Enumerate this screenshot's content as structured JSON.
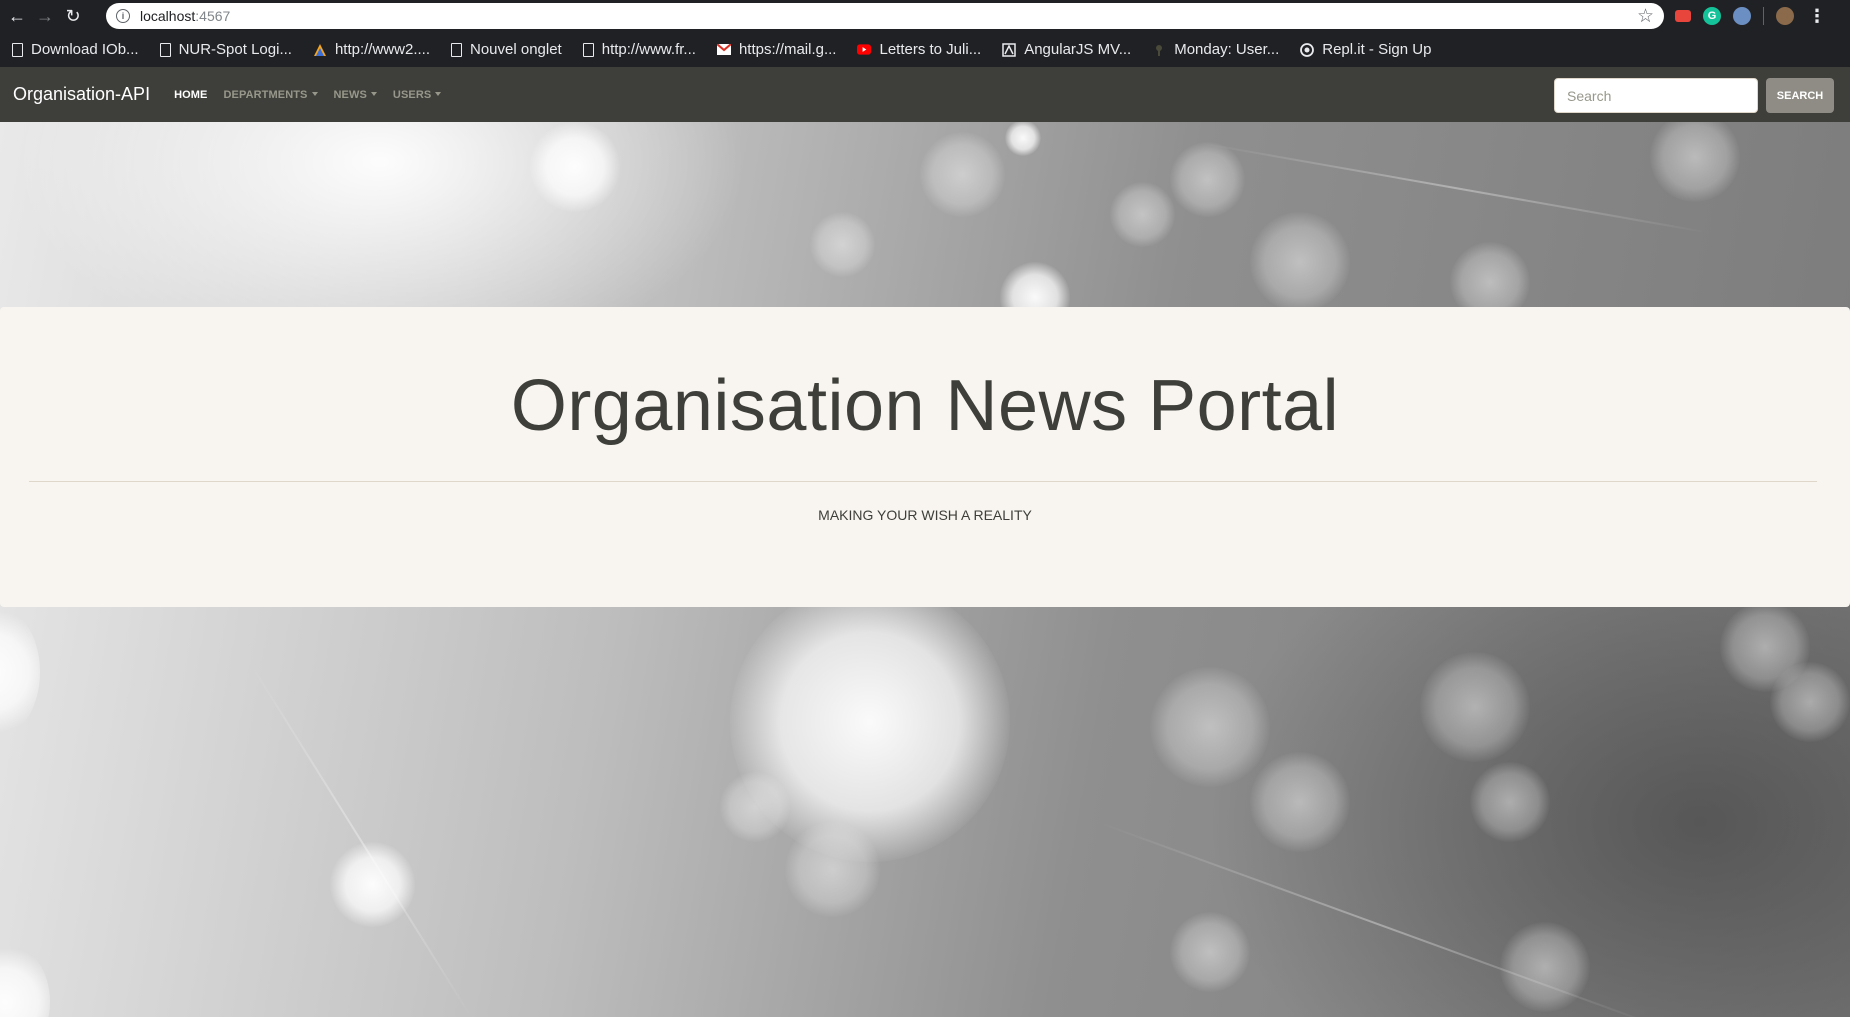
{
  "browser": {
    "url_host": "localhost",
    "url_port": ":4567",
    "bookmarks": [
      {
        "label": "Download IOb...",
        "icon": "document-icon"
      },
      {
        "label": "NUR-Spot Logi...",
        "icon": "document-icon"
      },
      {
        "label": "http://www2....",
        "icon": "triangle-logo-icon"
      },
      {
        "label": "Nouvel onglet",
        "icon": "document-icon"
      },
      {
        "label": "http://www.fr...",
        "icon": "document-icon"
      },
      {
        "label": "https://mail.g...",
        "icon": "gmail-icon"
      },
      {
        "label": "Letters to Juli...",
        "icon": "youtube-icon"
      },
      {
        "label": "AngularJS MV...",
        "icon": "angular-icon"
      },
      {
        "label": "Monday: User...",
        "icon": "monday-icon"
      },
      {
        "label": "Repl.it - Sign Up",
        "icon": "replit-icon"
      }
    ]
  },
  "navbar": {
    "brand": "Organisation-API",
    "links": [
      {
        "label": "HOME",
        "active": true,
        "dropdown": false
      },
      {
        "label": "DEPARTMENTS",
        "active": false,
        "dropdown": true
      },
      {
        "label": "NEWS",
        "active": false,
        "dropdown": true
      },
      {
        "label": "USERS",
        "active": false,
        "dropdown": true
      }
    ],
    "search": {
      "placeholder": "Search",
      "button_label": "SEARCH"
    }
  },
  "jumbotron": {
    "title": "Organisation News Portal",
    "subtitle": "MAKING YOUR WISH A REALITY"
  },
  "colors": {
    "navbar_bg": "#3e3f3a",
    "jumbotron_bg": "#f8f5f0",
    "search_button_bg": "#8e8c84",
    "text_dark": "#3e3f3a"
  }
}
